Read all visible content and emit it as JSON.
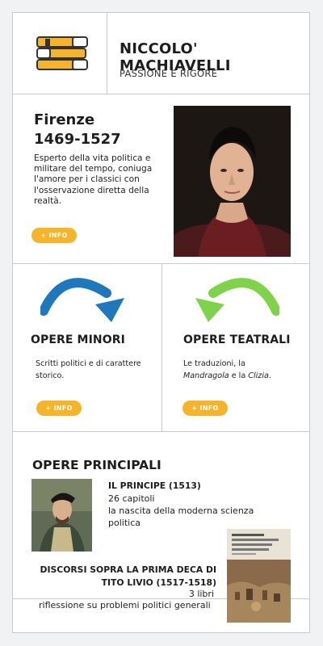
{
  "header": {
    "title": "NICCOLO' MACHIAVELLI",
    "subtitle": "PASSIONE E RIGORE",
    "logo_icon": "books-icon"
  },
  "bio": {
    "city": "Firenze",
    "years": "1469-1527",
    "text": "Esperto della vita politica e militare del tempo, coniuga l'amore per i classici con l'osservazione diretta della realtà.",
    "button": "+ INFO"
  },
  "opere_minori": {
    "title": "OPERE MINORI",
    "text": "Scritti politici e di carattere storico.",
    "button": "+ INFO",
    "arrow_color": "#1f78bd"
  },
  "opere_teatrali": {
    "title": "OPERE TEATRALI",
    "text_prefix": "Le traduzioni, la ",
    "text_italic1": "Mandragola",
    "text_mid": " e la ",
    "text_italic2": "Clizia",
    "text_suffix": ".",
    "button": "+ INFO",
    "arrow_color": "#7ed34a"
  },
  "opere_principali": {
    "title": "OPERE PRINCIPALI",
    "principe": {
      "title": "IL PRINCIPE (1513)",
      "line1": "26 capitoli",
      "line2": "la nascita della moderna scienza",
      "line3": "politica"
    },
    "discorsi": {
      "title_line1": "DISCORSI SOPRA LA PRIMA DECA DI",
      "title_line2": "TITO LIVIO (1517-1518)",
      "line1": "3 libri",
      "line2": "riflessione su problemi politici generali"
    }
  },
  "colors": {
    "accent": "#f6b42b",
    "border": "#c9c9c9"
  }
}
